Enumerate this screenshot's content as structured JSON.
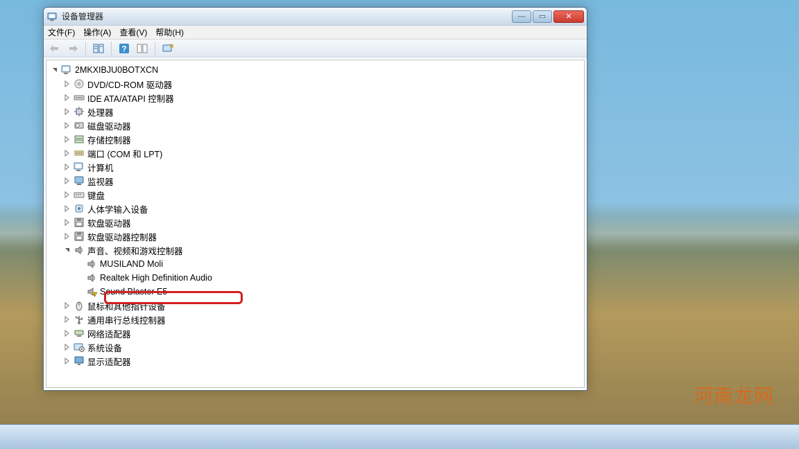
{
  "window": {
    "title": "设备管理器",
    "menus": {
      "file": "文件(F)",
      "action": "操作(A)",
      "view": "查看(V)",
      "help": "帮助(H)"
    },
    "buttons": {
      "min": "—",
      "max": "▭",
      "close": "✕"
    }
  },
  "root": "2MKXIBJU0BOTXCN",
  "nodes": {
    "n0": "DVD/CD-ROM 驱动器",
    "n1": "IDE ATA/ATAPI 控制器",
    "n2": "处理器",
    "n3": "磁盘驱动器",
    "n4": "存储控制器",
    "n5": "端口 (COM 和 LPT)",
    "n6": "计算机",
    "n7": "监视器",
    "n8": "键盘",
    "n9": "人体学输入设备",
    "n10": "软盘驱动器",
    "n11": "软盘驱动器控制器",
    "n12": "声音、视频和游戏控制器",
    "n12a": "MUSILAND Moli",
    "n12b": "Realtek High Definition Audio",
    "n12c": "Sound Blaster E5",
    "n13": "鼠标和其他指针设备",
    "n14": "通用串行总线控制器",
    "n15": "网络适配器",
    "n16": "系统设备",
    "n17": "显示适配器"
  },
  "watermark": "河南龙网"
}
